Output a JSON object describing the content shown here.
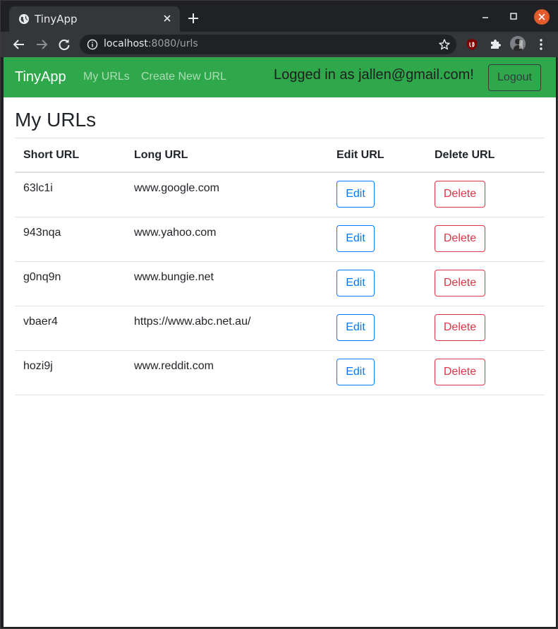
{
  "browser": {
    "tab_title": "TinyApp",
    "url_host": "localhost",
    "url_rest": ":8080/urls"
  },
  "app": {
    "brand": "TinyApp",
    "nav": {
      "my_urls": "My URLs",
      "create_new": "Create New URL"
    },
    "logged_in_text": "Logged in as jallen@gmail.com!",
    "logout_label": "Logout",
    "colors": {
      "navbar": "#2ea84a",
      "edit": "#007bff",
      "delete": "#dc3545"
    }
  },
  "main": {
    "heading": "My URLs",
    "columns": [
      "Short URL",
      "Long URL",
      "Edit URL",
      "Delete URL"
    ],
    "edit_label": "Edit",
    "delete_label": "Delete",
    "rows": [
      {
        "short": "63lc1i",
        "long": "www.google.com"
      },
      {
        "short": "943nqa",
        "long": "www.yahoo.com"
      },
      {
        "short": "g0nq9n",
        "long": "www.bungie.net"
      },
      {
        "short": "vbaer4",
        "long": "https://www.abc.net.au/"
      },
      {
        "short": "hozi9j",
        "long": "www.reddit.com"
      }
    ]
  }
}
